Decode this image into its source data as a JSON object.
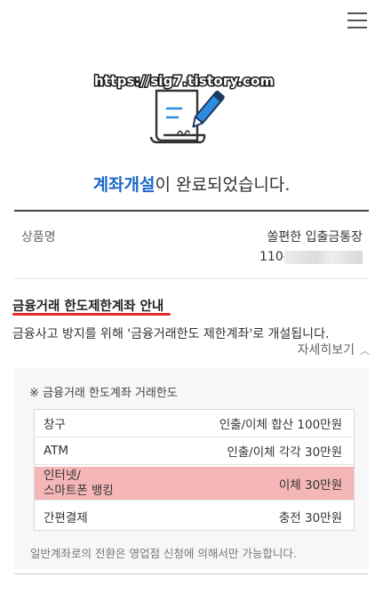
{
  "watermark": "https://sig7.tistory.com",
  "completion": {
    "highlight": "계좌개설",
    "rest": "이 완료되었습니다."
  },
  "product": {
    "label": "상품명",
    "name": "쏠편한 입출금통장",
    "account_prefix": "110-"
  },
  "limit_notice": {
    "title": "금융거래 한도제한계좌 안내",
    "description": "금융사고 방지를 위해 '금융거래한도 제한계좌'로 개설됩니다.",
    "detail_link": "자세히보기"
  },
  "limit_table": {
    "title": "※ 금융거래 한도계좌 거래한도",
    "rows": [
      {
        "label": "창구",
        "value": "인출/이체 합산 100만원"
      },
      {
        "label": "ATM",
        "value": "인출/이체 각각 30만원"
      },
      {
        "label_line1": "인터넷/",
        "label_line2": "스마트폰 뱅킹",
        "value": "이체 30만원"
      },
      {
        "label": "간편결제",
        "value": "충전 30만원"
      }
    ],
    "note": "일반계좌로의 전환은 영업점 신청에 의해서만 가능합니다."
  },
  "colors": {
    "accent": "#1a6ac9",
    "underline": "#e52b2b",
    "highlight_row": "#f4b6b6"
  },
  "icons": [
    "menu-icon",
    "document-pen-icon",
    "chevron-up-icon"
  ]
}
